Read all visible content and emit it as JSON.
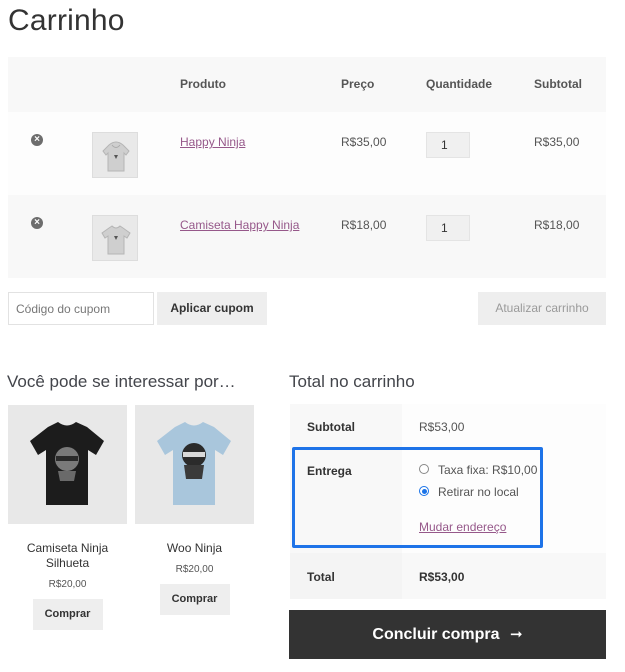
{
  "page": {
    "title": "Carrinho"
  },
  "cart": {
    "headers": {
      "product": "Produto",
      "price": "Preço",
      "quantity": "Quantidade",
      "subtotal": "Subtotal"
    },
    "remove_icon": "×",
    "items": [
      {
        "name": "Happy Ninja",
        "price": "R$35,00",
        "quantity": "1",
        "subtotal": "R$35,00",
        "image": "hoodie-gray"
      },
      {
        "name": "Camiseta Happy Ninja",
        "price": "R$18,00",
        "quantity": "1",
        "subtotal": "R$18,00",
        "image": "tshirt-gray"
      }
    ],
    "coupon_placeholder": "Código do cupom",
    "apply_coupon": "Aplicar cupom",
    "update_cart": "Atualizar carrinho"
  },
  "cross_sells": {
    "title": "Você pode se interessar por…",
    "items": [
      {
        "name": "Camiseta Ninja Silhueta",
        "price": "R$20,00",
        "button": "Comprar",
        "image": "tshirt-black"
      },
      {
        "name": "Woo Ninja",
        "price": "R$20,00",
        "button": "Comprar",
        "image": "tshirt-lightblue"
      }
    ]
  },
  "totals": {
    "title": "Total no carrinho",
    "subtotal_label": "Subtotal",
    "subtotal_value": "R$53,00",
    "shipping_label": "Entrega",
    "shipping_options": [
      {
        "label": "Taxa fixa: R$10,00",
        "selected": false
      },
      {
        "label": "Retirar no local",
        "selected": true
      }
    ],
    "change_address": "Mudar endereço",
    "total_label": "Total",
    "total_value": "R$53,00",
    "checkout_button": "Concluir compra",
    "checkout_arrow": "➞"
  },
  "colors": {
    "link": "#96588a",
    "highlight": "#1e73e8",
    "checkout_bg": "#333333"
  }
}
